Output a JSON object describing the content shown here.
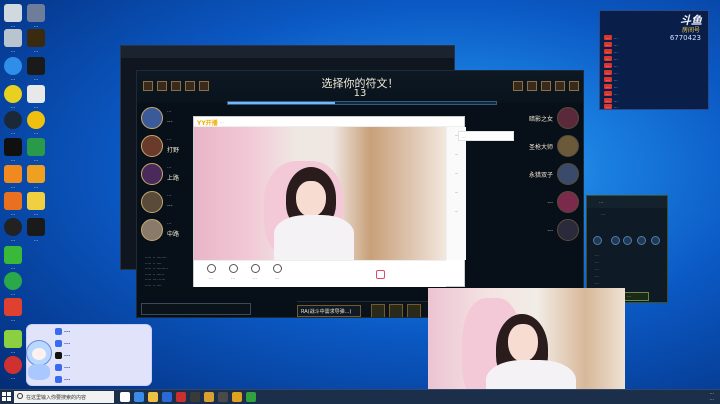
{
  "desktop": {
    "icons": [
      {
        "label": "..."
      },
      {
        "label": "..."
      },
      {
        "label": "..."
      },
      {
        "label": "..."
      },
      {
        "label": "..."
      },
      {
        "label": "..."
      },
      {
        "label": "..."
      },
      {
        "label": "..."
      },
      {
        "label": "..."
      },
      {
        "label": "..."
      },
      {
        "label": "..."
      },
      {
        "label": "..."
      },
      {
        "label": "..."
      },
      {
        "label": "..."
      },
      {
        "label": "..."
      },
      {
        "label": "..."
      },
      {
        "label": "..."
      },
      {
        "label": "..."
      },
      {
        "label": "..."
      },
      {
        "label": "..."
      },
      {
        "label": "..."
      },
      {
        "label": "..."
      },
      {
        "label": "..."
      },
      {
        "label": "..."
      }
    ]
  },
  "game": {
    "title": "选择你的符文！",
    "timer": "13",
    "timer_progress": 0.4,
    "left_team": [
      {
        "role": "...",
        "name": "..."
      },
      {
        "role": "...",
        "name": "打野"
      },
      {
        "role": "...",
        "name": "上路"
      },
      {
        "role": "...",
        "name": "..."
      },
      {
        "role": "...",
        "name": "中路"
      }
    ],
    "right_team": [
      {
        "name": "暗影之女"
      },
      {
        "name": "圣枪大师"
      },
      {
        "name": "永猎双子"
      },
      {
        "name": "..."
      },
      {
        "name": "..."
      }
    ],
    "rune_select_label": "RA(战斗中需求导弹...)"
  },
  "yy": {
    "logo": "YY开播",
    "header_sub": "...",
    "tools": [
      {
        "label": "..."
      },
      {
        "label": "..."
      },
      {
        "label": "..."
      },
      {
        "label": "..."
      }
    ],
    "side_items": [
      {
        "label": "..."
      },
      {
        "label": "..."
      },
      {
        "label": "..."
      },
      {
        "label": "..."
      },
      {
        "label": "..."
      }
    ],
    "side_link_title": "...",
    "side_link_value": "..."
  },
  "stats": {
    "brand": "斗鱼",
    "brand_sub": "房间号",
    "room_number": "6770423",
    "rows": [
      {
        "tag": "...",
        "text": "..."
      },
      {
        "tag": "...",
        "text": "..."
      },
      {
        "tag": "...",
        "text": "..."
      },
      {
        "tag": "...",
        "text": "..."
      },
      {
        "tag": "...",
        "text": "..."
      },
      {
        "tag": "...",
        "text": "..."
      },
      {
        "tag": "...",
        "text": "..."
      },
      {
        "tag": "...",
        "text": "..."
      },
      {
        "tag": "...",
        "text": "..."
      },
      {
        "tag": "...",
        "text": "..."
      },
      {
        "tag": "...",
        "text": "..."
      },
      {
        "tag": "...",
        "text": "..."
      }
    ]
  },
  "runes": {
    "title": "...",
    "subtitle": "...",
    "button": "...",
    "lines": [
      "...",
      "...",
      "...",
      "...",
      "...",
      "..."
    ]
  },
  "overlay": {
    "lines": [
      "...",
      "...",
      "...",
      "...",
      "..."
    ]
  },
  "taskbar": {
    "search_placeholder": "在这里输入你要搜索的内容",
    "time": "...",
    "date": "..."
  },
  "colors": {
    "accent": "#1a7fe0",
    "gold": "#c8aa6e",
    "douyu_red": "#d9362f"
  }
}
